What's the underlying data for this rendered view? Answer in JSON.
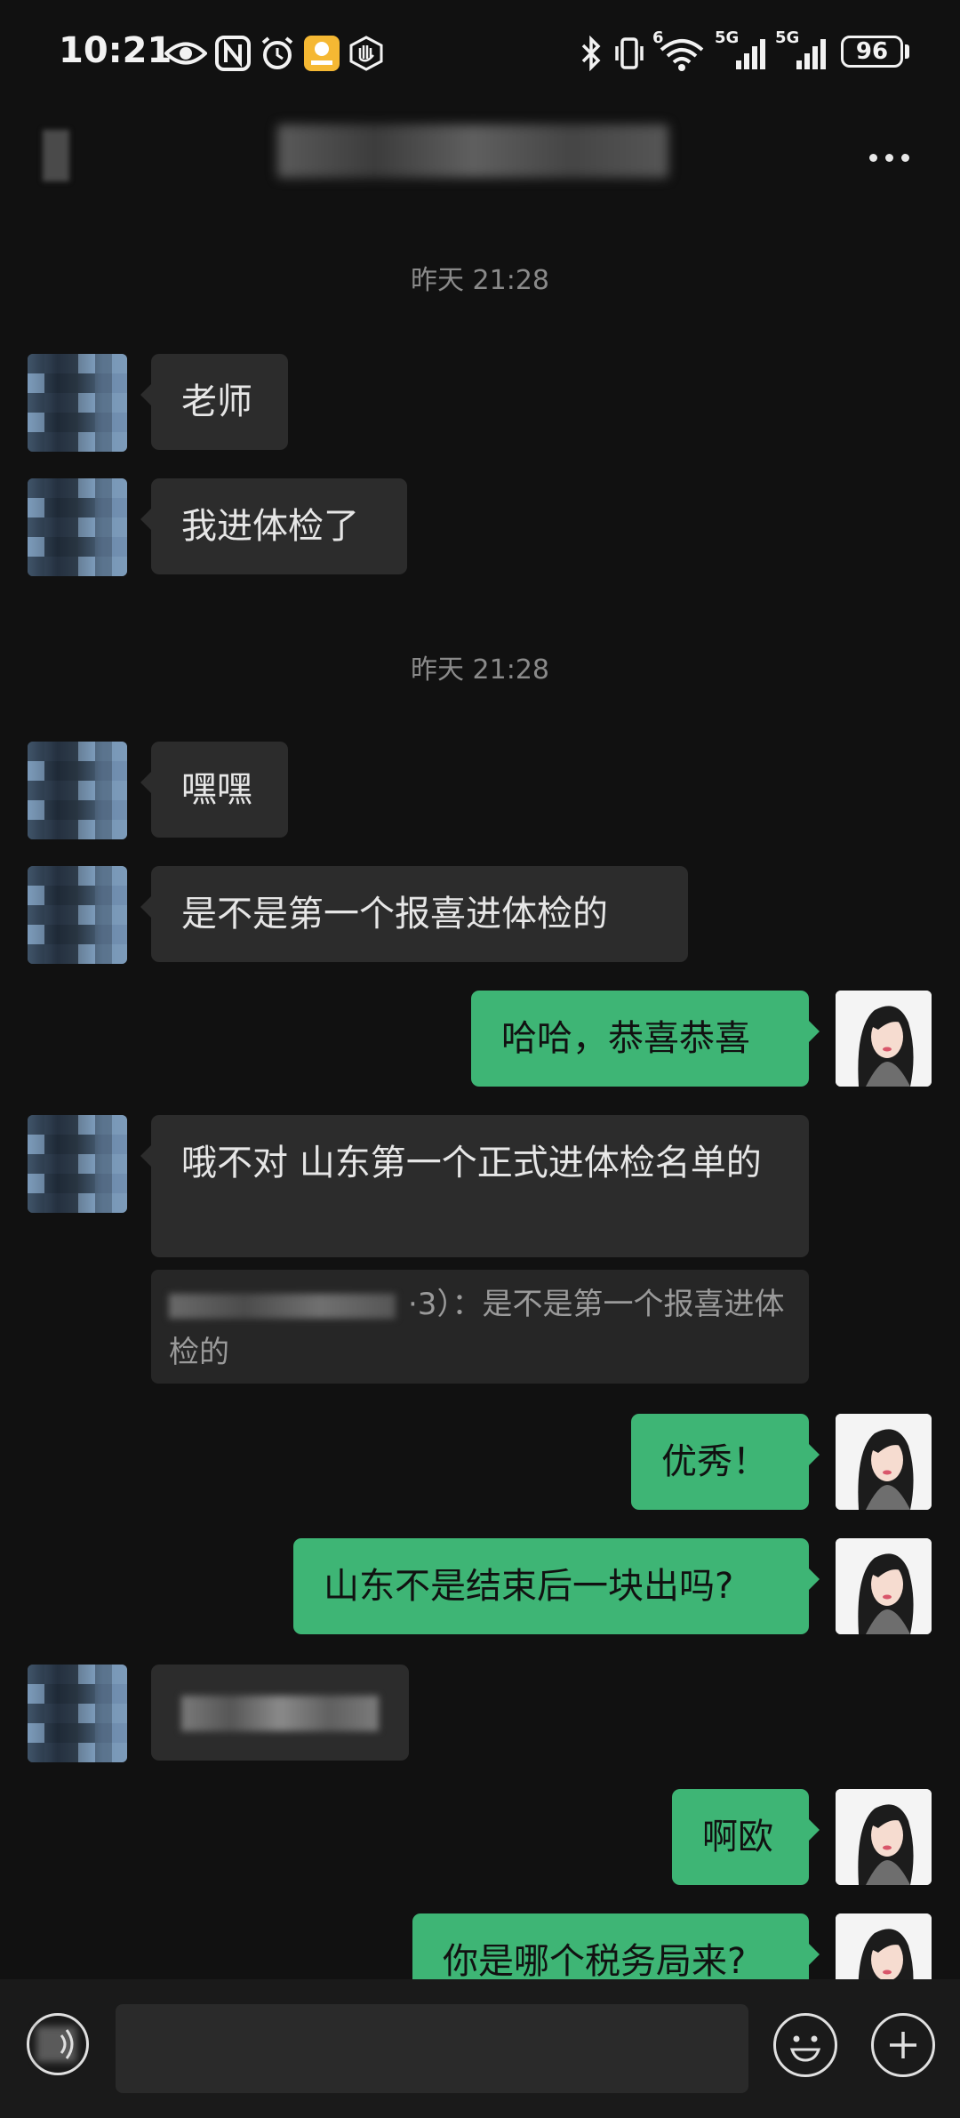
{
  "status_bar": {
    "time": "10:21",
    "battery": "96",
    "network_1": "5G",
    "network_2": "5G",
    "wifi_badge": "6"
  },
  "header": {
    "title": "",
    "more_icon": "more-dots-icon"
  },
  "timestamps": [
    "昨天 21:28",
    "昨天 21:28"
  ],
  "messages": {
    "m1": "老师",
    "m2": "我进体检了",
    "m3": "嘿嘿",
    "m4": "是不是第一个报喜进体检的",
    "m5": "哈哈，恭喜恭喜",
    "m6": "哦不对 山东第一个正式进体检名单的",
    "m6_quote": "·3）：是不是第一个报喜进体检的",
    "m7": "优秀！",
    "m8": "山东不是结束后一块出吗?",
    "m9": "",
    "m10": "啊欧",
    "m11": "你是哪个税务局来?"
  },
  "input_bar": {
    "placeholder": "",
    "voice_icon": "voice-icon",
    "emoji_icon": "emoji-icon",
    "plus_icon": "plus-icon"
  },
  "colors": {
    "background": "#111111",
    "incoming_bubble": "#2c2c2c",
    "outgoing_bubble": "#3eb575",
    "timestamp": "#8a8a8a"
  }
}
